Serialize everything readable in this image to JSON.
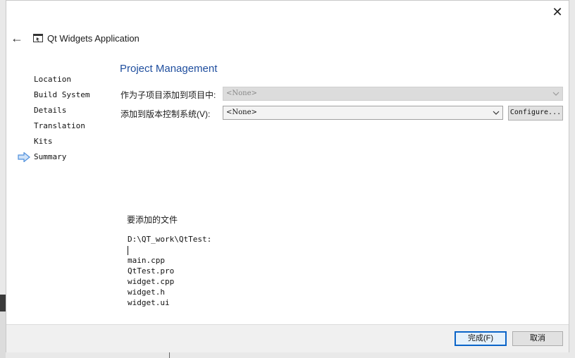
{
  "window": {
    "title": "Qt Widgets Application",
    "close_glyph": "✕",
    "back_glyph": "←"
  },
  "steps": [
    {
      "label": "Location"
    },
    {
      "label": "Build System"
    },
    {
      "label": "Details"
    },
    {
      "label": "Translation"
    },
    {
      "label": "Kits"
    },
    {
      "label": "Summary",
      "current": true
    }
  ],
  "page": {
    "title": "Project Management",
    "add_subproject_label": "作为子项目添加到项目中:",
    "add_subproject_value": "<None>",
    "vcs_label": "添加到版本控制系统(V):",
    "vcs_value": "<None>",
    "configure_label": "Configure..."
  },
  "files": {
    "heading": "要添加的文件",
    "directory": "D:\\QT_work\\QtTest:",
    "items": [
      "main.cpp",
      "QtTest.pro",
      "widget.cpp",
      "widget.h",
      "widget.ui"
    ]
  },
  "buttons": {
    "finish": "完成(F)",
    "cancel": "取消"
  },
  "colors": {
    "accent": "#1f4e9e",
    "arrow": "#4f8fdc",
    "focus_border": "#0a64c8"
  }
}
